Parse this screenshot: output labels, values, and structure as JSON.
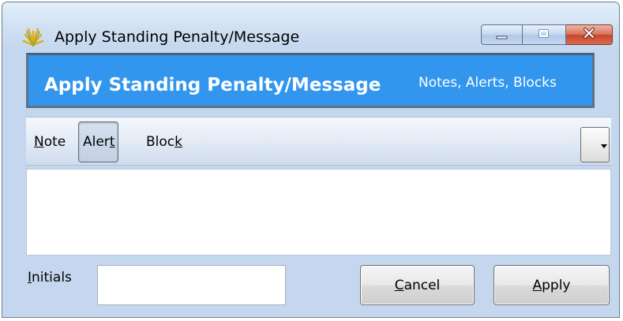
{
  "window": {
    "title": "Apply Standing Penalty/Message",
    "controls": {
      "minimize_icon": "minimize-icon",
      "maximize_icon": "maximize-icon",
      "close_icon": "close-icon"
    }
  },
  "banner": {
    "title": "Apply Standing Penalty/Message",
    "subtitle": "Notes, Alerts, Blocks",
    "color": "#3296ee"
  },
  "toolbar": {
    "items": [
      {
        "label_pre": "",
        "label_key": "N",
        "label_post": "ote",
        "selected": false
      },
      {
        "label_pre": "Aler",
        "label_key": "t",
        "label_post": "",
        "selected": true
      },
      {
        "label_pre": "Bloc",
        "label_key": "k",
        "label_post": "",
        "selected": false
      }
    ],
    "dropdown_icon": "caret-down-icon"
  },
  "message": {
    "value": "",
    "placeholder": ""
  },
  "initials": {
    "label_key": "I",
    "label_post": "nitials",
    "value": "",
    "placeholder": ""
  },
  "buttons": {
    "cancel": {
      "label_key": "C",
      "label_post": "ancel"
    },
    "apply": {
      "label_key": "A",
      "label_post": "pply"
    }
  }
}
